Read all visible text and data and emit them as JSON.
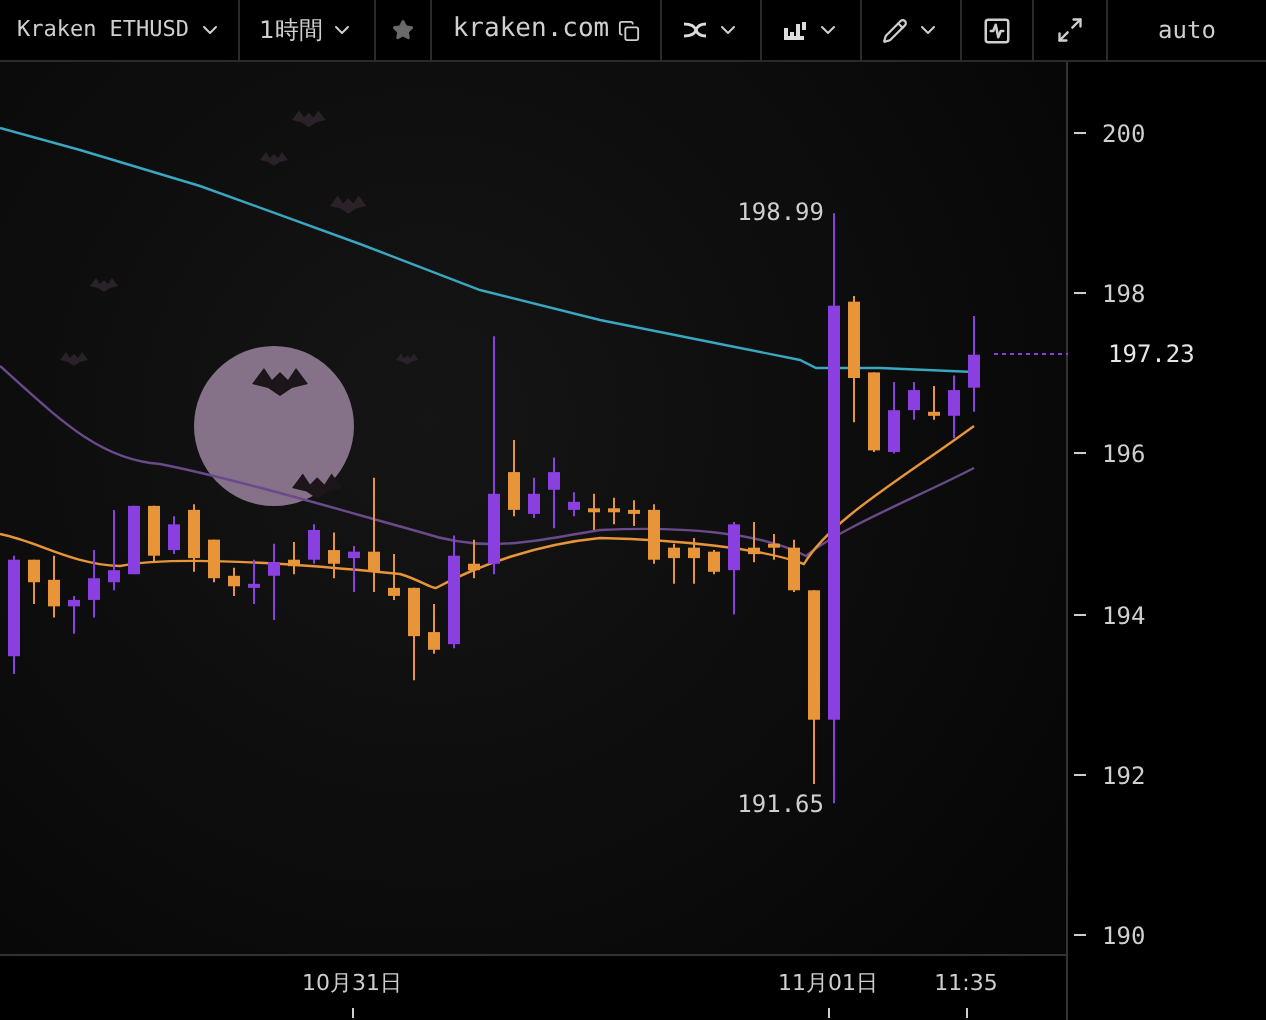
{
  "toolbar": {
    "symbol": "Kraken ETHUSD",
    "interval": "1時間",
    "site": "kraken.com",
    "scale_mode": "auto"
  },
  "chart": {
    "high_label": "198.99",
    "low_label": "191.65",
    "price_axis": [
      "200",
      "198",
      "196",
      "194",
      "192",
      "190"
    ],
    "last_price": "197.23",
    "time_axis": [
      "10月31日",
      "11月01日",
      "11:35"
    ],
    "chart_data": {
      "type": "candlestick",
      "ohlc": [
        [
          193.48,
          194.73,
          193.26,
          194.68
        ],
        [
          194.68,
          194.68,
          194.13,
          194.4
        ],
        [
          194.43,
          194.73,
          193.96,
          194.1
        ],
        [
          194.1,
          194.23,
          193.76,
          194.18
        ],
        [
          194.18,
          194.8,
          193.96,
          194.45
        ],
        [
          194.4,
          195.3,
          194.3,
          194.55
        ],
        [
          194.5,
          195.35,
          194.5,
          195.35
        ],
        [
          195.35,
          195.35,
          194.65,
          194.73
        ],
        [
          194.8,
          195.22,
          194.75,
          195.12
        ],
        [
          195.3,
          195.37,
          194.53,
          194.7
        ],
        [
          194.93,
          194.93,
          194.4,
          194.45
        ],
        [
          194.48,
          194.58,
          194.23,
          194.35
        ],
        [
          194.33,
          194.68,
          194.13,
          194.38
        ],
        [
          194.48,
          194.88,
          193.93,
          194.65
        ],
        [
          194.68,
          194.9,
          194.5,
          194.6
        ],
        [
          194.68,
          195.12,
          194.63,
          195.05
        ],
        [
          194.8,
          195.02,
          194.45,
          194.63
        ],
        [
          194.7,
          194.85,
          194.28,
          194.78
        ],
        [
          194.78,
          195.7,
          194.28,
          194.53
        ],
        [
          194.33,
          194.75,
          194.18,
          194.23
        ],
        [
          194.33,
          194.33,
          193.18,
          193.73
        ],
        [
          193.78,
          194.13,
          193.51,
          193.56
        ],
        [
          193.63,
          194.98,
          193.58,
          194.73
        ],
        [
          194.63,
          194.93,
          194.45,
          194.55
        ],
        [
          194.63,
          197.46,
          194.5,
          195.5
        ],
        [
          195.77,
          196.17,
          195.22,
          195.3
        ],
        [
          195.25,
          195.7,
          195.2,
          195.5
        ],
        [
          195.55,
          195.95,
          195.07,
          195.77
        ],
        [
          195.3,
          195.52,
          195.22,
          195.4
        ],
        [
          195.32,
          195.5,
          195.05,
          195.3
        ],
        [
          195.32,
          195.45,
          195.12,
          195.27
        ],
        [
          195.3,
          195.42,
          195.1,
          195.25
        ],
        [
          195.3,
          195.37,
          194.63,
          194.68
        ],
        [
          194.83,
          194.88,
          194.38,
          194.7
        ],
        [
          194.83,
          194.95,
          194.38,
          194.7
        ],
        [
          194.78,
          194.8,
          194.5,
          194.53
        ],
        [
          194.55,
          195.15,
          194.0,
          195.12
        ],
        [
          194.83,
          195.15,
          194.65,
          194.75
        ],
        [
          194.88,
          195.0,
          194.68,
          194.83
        ],
        [
          194.83,
          194.93,
          194.28,
          194.3
        ],
        [
          194.3,
          194.3,
          191.89,
          192.69
        ],
        [
          192.69,
          198.99,
          191.65,
          197.84
        ],
        [
          197.89,
          197.96,
          196.39,
          196.94
        ],
        [
          197.01,
          197.01,
          196.02,
          196.04
        ],
        [
          196.02,
          196.89,
          196.0,
          196.54
        ],
        [
          196.54,
          196.89,
          196.42,
          196.79
        ],
        [
          196.52,
          196.84,
          196.42,
          196.47
        ],
        [
          196.47,
          196.97,
          196.19,
          196.79
        ],
        [
          196.82,
          197.71,
          196.52,
          197.23
        ]
      ]
    }
  }
}
